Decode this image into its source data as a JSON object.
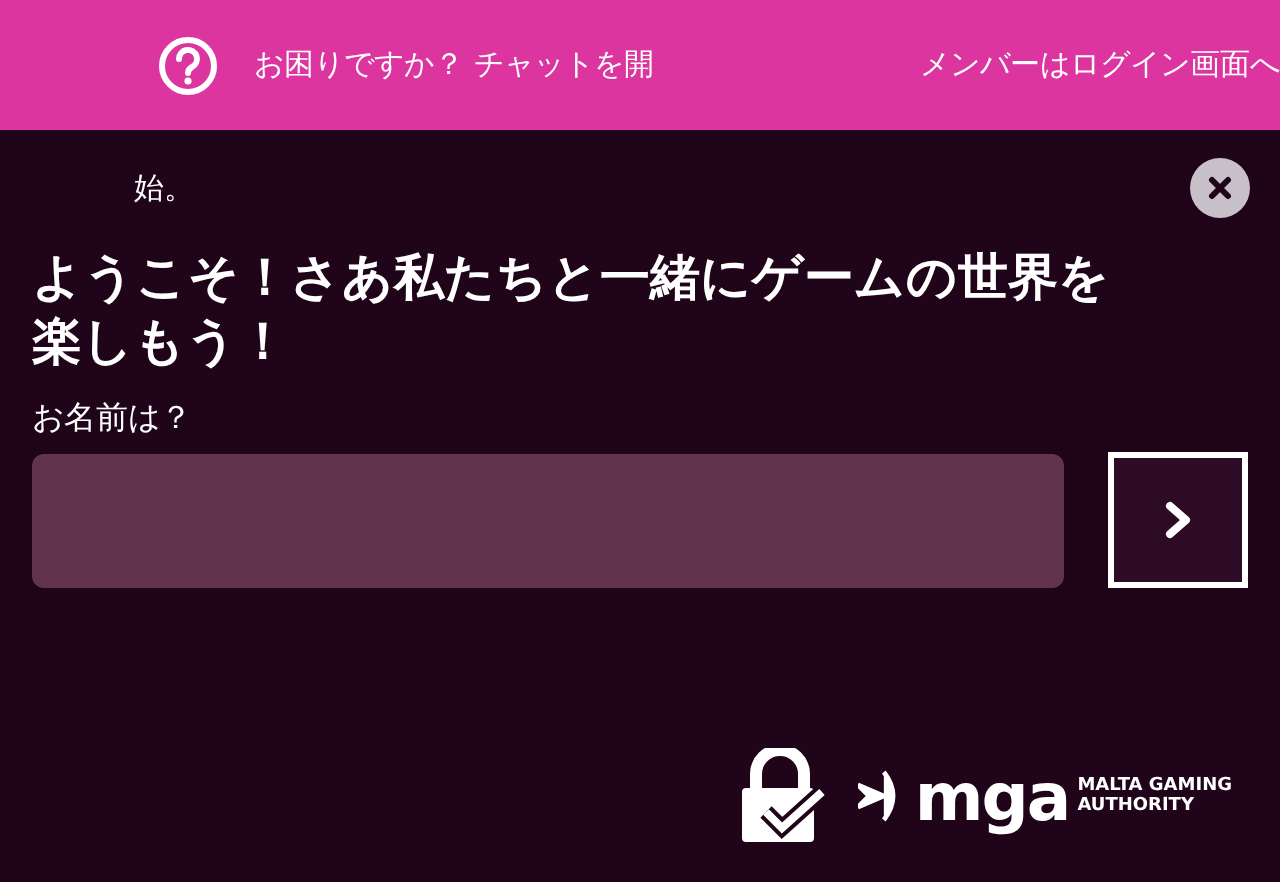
{
  "banner": {
    "help_text": "お困りですか？ チャットを開",
    "help_text_overflow": "始。",
    "login_text": "メンバーはログイン画面へ"
  },
  "heading": "ようこそ！さあ私たちと一緒にゲームの世界を楽しもう！",
  "name_label": "お名前は？",
  "footer": {
    "logo_text": "mga",
    "logo_caption": [
      "MALTA GAMING",
      "AUTHORITY"
    ]
  }
}
